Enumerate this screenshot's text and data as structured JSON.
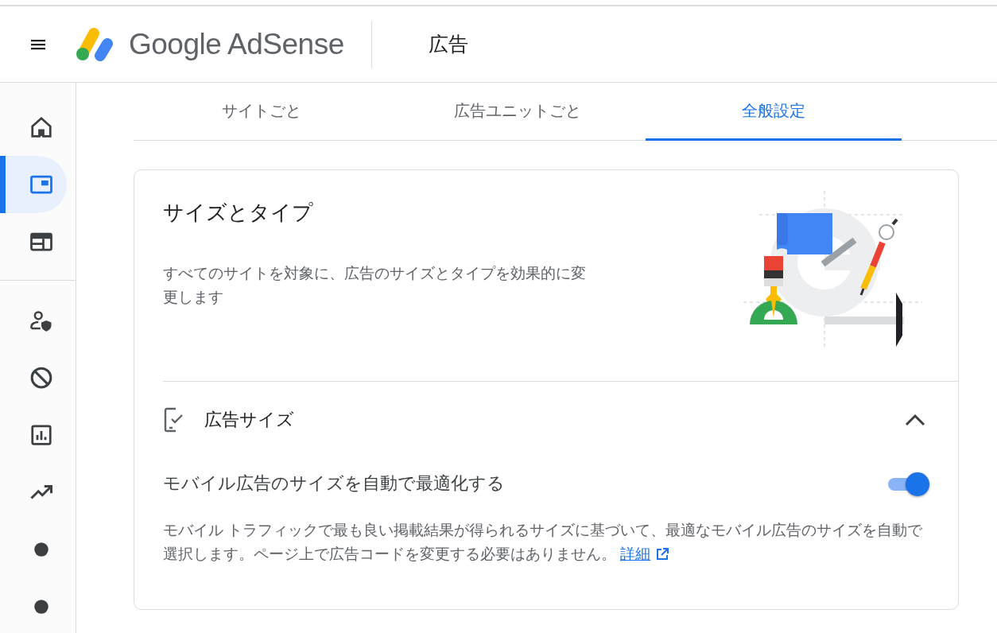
{
  "header": {
    "product": "Google AdSense",
    "page_title": "広告"
  },
  "sidebar": {
    "items": [
      {
        "kind": "home",
        "selected": false
      },
      {
        "kind": "ads",
        "selected": true
      },
      {
        "kind": "layout",
        "selected": false
      },
      {
        "kind": "divider"
      },
      {
        "kind": "privacy",
        "selected": false
      },
      {
        "kind": "block",
        "selected": false
      },
      {
        "kind": "report",
        "selected": false
      },
      {
        "kind": "trend",
        "selected": false
      },
      {
        "kind": "dot",
        "selected": false
      },
      {
        "kind": "dot",
        "selected": false
      }
    ]
  },
  "tabs": [
    {
      "label": "サイトごと",
      "selected": false
    },
    {
      "label": "広告ユニットごと",
      "selected": false
    },
    {
      "label": "全般設定",
      "selected": true
    }
  ],
  "card": {
    "title": "サイズとタイプ",
    "description": "すべてのサイトを対象に、広告のサイズとタイプを効果的に変更します",
    "section": {
      "title": "広告サイズ",
      "expanded": true,
      "setting": {
        "label": "モバイル広告のサイズを自動で最適化する",
        "on": true,
        "description": "モバイル トラフィックで最も良い掲載結果が得られるサイズに基づいて、最適なモバイル広告のサイズを自動で選択します。ページ上で広告コードを変更する必要はありません。",
        "link": "詳細"
      }
    }
  }
}
